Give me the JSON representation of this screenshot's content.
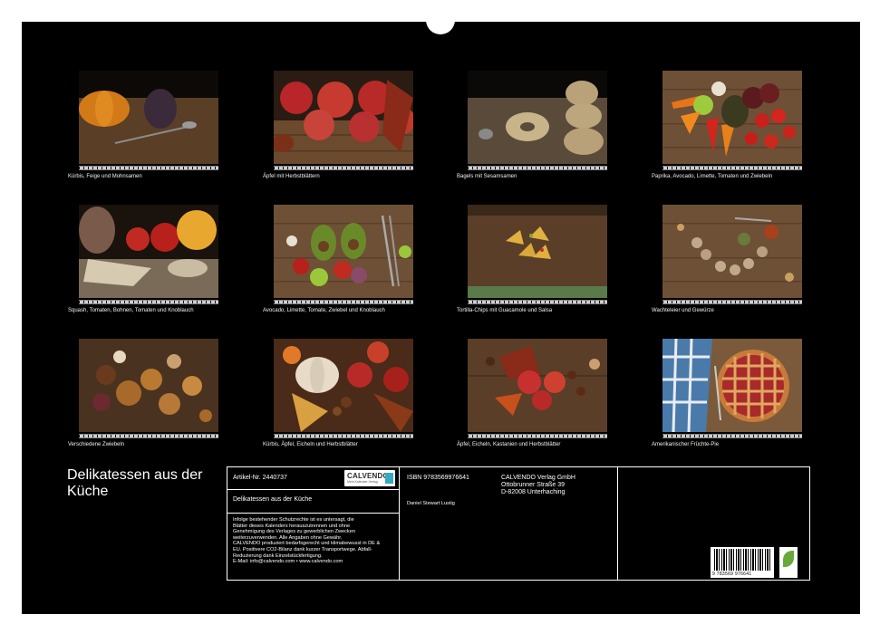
{
  "calendar": {
    "title": "Delikatessen aus der Küche",
    "photos": [
      {
        "caption": "Kürbis, Feige und Mohnsamen",
        "scene": "pumpkin-fig"
      },
      {
        "caption": "Äpfel mit Herbstblättern",
        "scene": "apples-leaves"
      },
      {
        "caption": "Bagels mit Sesamsamen",
        "scene": "bagels"
      },
      {
        "caption": "Paprika, Avocado, Limette, Tomaten und Zwiebeln",
        "scene": "peppers"
      },
      {
        "caption": "Squash, Tomaten, Bohnen, Tomaten und Knoblauch",
        "scene": "squash"
      },
      {
        "caption": "Avocado, Limette, Tomate, Zwiebel und Knoblauch",
        "scene": "avocado"
      },
      {
        "caption": "Tortilla-Chips mit Guacamole und Salsa",
        "scene": "tortilla"
      },
      {
        "caption": "Wachteleier und Gewürze",
        "scene": "quail-eggs"
      },
      {
        "caption": "Verschiedene Zwiebeln",
        "scene": "onions"
      },
      {
        "caption": "Kürbis, Äpfel, Eicheln und Herbstblätter",
        "scene": "autumn"
      },
      {
        "caption": "Äpfel, Eicheln, Kastanien und Herbstblätter",
        "scene": "apples-chestnuts"
      },
      {
        "caption": "Amerikanischer Früchte-Pie",
        "scene": "pie"
      }
    ]
  },
  "info": {
    "article": "Artikel-Nr. 2440737",
    "product_title": "Delikatessen aus der Küche",
    "legal": [
      "Infolge bestehender Schutzrechte ist es untersagt, die",
      "Blätter dieses Kalenders herauszutrennen und ohne",
      "Genehmigung des Verlages zu gewerblichen Zwecken",
      "weiterzuverwenden. Alle Angaben ohne Gewähr.",
      "CALVENDO produziert bedarfsgerecht und klimabewusst in DE &",
      "EU. Positivere CO2-Bilanz dank kurzer Transportwege. Abfall-",
      "Reduzierung dank Einzelstückfertigung.",
      "E-Mail: info@calvendo.com • www.calvendo.com"
    ],
    "isbn": "ISBN 9783569976641",
    "author": "Daniel Stewart Lustig",
    "publisher": [
      "CALVENDO Verlag GmbH",
      "Ottobrunner Straße 39",
      "D-82008 Unterhaching"
    ],
    "logo_name": "CALVENDO",
    "logo_sub": "Mein Kalender-Verlag",
    "barcode_digits": "9 783569 976641"
  },
  "colors": {
    "background": "#000000",
    "text": "#ffffff",
    "logo_accent": "#36a8c2",
    "eco_leaf": "#6aa83a"
  }
}
